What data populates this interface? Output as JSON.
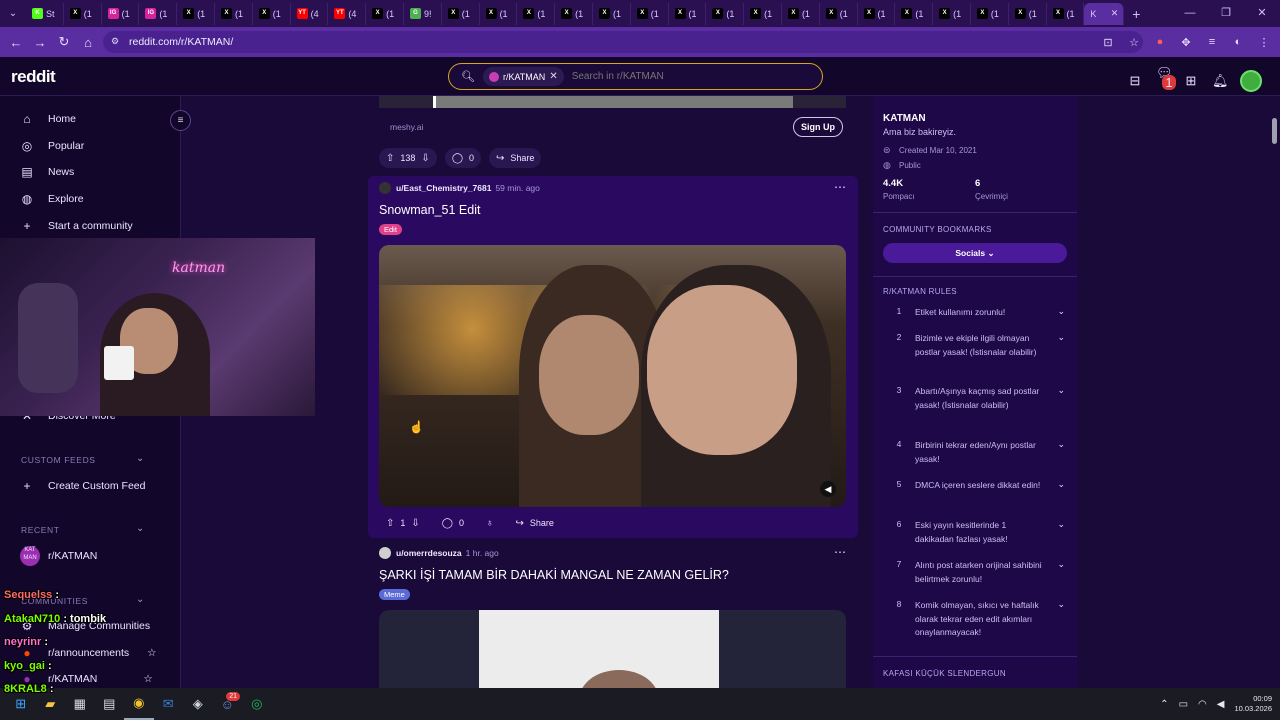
{
  "browser": {
    "tabs": [
      {
        "label": "St",
        "icon": "K",
        "color": "#53fc18"
      },
      {
        "label": "(1",
        "icon": "X",
        "color": "#000000"
      },
      {
        "label": "(1",
        "icon": "IG",
        "color": "#d6249f"
      },
      {
        "label": "(1",
        "icon": "IG",
        "color": "#d6249f"
      },
      {
        "label": "(1",
        "icon": "X",
        "color": "#000000"
      },
      {
        "label": "(1",
        "icon": "X",
        "color": "#000000"
      },
      {
        "label": "(1",
        "icon": "X",
        "color": "#000000"
      },
      {
        "label": "(4",
        "icon": "YT",
        "color": "#ff0000"
      },
      {
        "label": "(4",
        "icon": "YT",
        "color": "#ff0000"
      },
      {
        "label": "(1",
        "icon": "X",
        "color": "#000000"
      },
      {
        "label": "9!",
        "icon": "G",
        "color": "#4caf50"
      },
      {
        "label": "(1",
        "icon": "X",
        "color": "#000000"
      },
      {
        "label": "(1",
        "icon": "X",
        "color": "#000000"
      },
      {
        "label": "(1",
        "icon": "X",
        "color": "#000000"
      },
      {
        "label": "(1",
        "icon": "X",
        "color": "#000000"
      },
      {
        "label": "(1",
        "icon": "X",
        "color": "#000000"
      },
      {
        "label": "(1",
        "icon": "X",
        "color": "#000000"
      },
      {
        "label": "(1",
        "icon": "X",
        "color": "#000000"
      },
      {
        "label": "(1",
        "icon": "X",
        "color": "#000000"
      },
      {
        "label": "(1",
        "icon": "X",
        "color": "#000000"
      },
      {
        "label": "(1",
        "icon": "X",
        "color": "#000000"
      },
      {
        "label": "(1",
        "icon": "X",
        "color": "#000000"
      },
      {
        "label": "(1",
        "icon": "X",
        "color": "#000000"
      },
      {
        "label": "(1",
        "icon": "X",
        "color": "#000000"
      },
      {
        "label": "(1",
        "icon": "X",
        "color": "#000000"
      },
      {
        "label": "(1",
        "icon": "X",
        "color": "#000000"
      },
      {
        "label": "(1",
        "icon": "X",
        "color": "#000000"
      },
      {
        "label": "(1",
        "icon": "X",
        "color": "#000000"
      }
    ],
    "active_tab_label": "K",
    "url": "reddit.com/r/KATMAN/"
  },
  "header": {
    "logo": "reddit",
    "search_chip": "r/KATMAN",
    "search_placeholder": "Search in r/KATMAN",
    "chat_badge": "1"
  },
  "leftnav": {
    "items": [
      {
        "label": "Home",
        "icon": "⌂"
      },
      {
        "label": "Popular",
        "icon": "◎"
      },
      {
        "label": "News",
        "icon": "▤"
      },
      {
        "label": "Explore",
        "icon": "◍"
      },
      {
        "label": "Start a community",
        "icon": "+"
      }
    ],
    "discover_more": "Discover More",
    "custom_feeds_heading": "CUSTOM FEEDS",
    "create_custom_feed": "Create Custom Feed",
    "recent_heading": "RECENT",
    "recent_item": "r/KATMAN",
    "recent_item_avatar": "KAT MAN",
    "communities_heading": "COMMUNITIES",
    "manage_communities": "Manage Communities",
    "announcements": "r/announcements",
    "katman": "r/KATMAN"
  },
  "chat_overlay": [
    {
      "user": "Sequelss",
      "msg": "",
      "color": "#ff6b6b"
    },
    {
      "user": "AtakaN710",
      "msg": "tombik",
      "color": "#7cfc00"
    },
    {
      "user": "neyrinr",
      "msg": "",
      "color": "#ff6fcf"
    },
    {
      "user": "kyo_gai",
      "msg": "",
      "color": "#7cfc00"
    },
    {
      "user": "8KRAL8",
      "msg": "",
      "color": "#7cfc00"
    }
  ],
  "feed": {
    "ad": {
      "source": "meshy.ai",
      "signup": "Sign Up",
      "votes": "138",
      "comments": "0",
      "share": "Share"
    },
    "post1": {
      "user": "u/East_Chemistry_7681",
      "time": "59 min. ago",
      "title": "Snowman_51 Edit",
      "flair": "Edit",
      "flair_color": "#e0418a",
      "votes": "1",
      "comments": "0",
      "share": "Share"
    },
    "post2": {
      "user": "u/omerrdesouza",
      "time": "1 hr. ago",
      "title": "ŞARKI İŞİ TAMAM BİR DAHAKİ MANGAL NE ZAMAN GELİR?",
      "flair": "Meme",
      "flair_color": "#5b6bd6"
    }
  },
  "sidebar": {
    "name": "KATMAN",
    "description": "Ama biz bakireyiz.",
    "created": "Created Mar 10, 2021",
    "visibility": "Public",
    "members": "4.4K",
    "members_label": "Pompacı",
    "online": "6",
    "online_label": "Çevrimiçi",
    "bookmarks_heading": "COMMUNITY BOOKMARKS",
    "socials": "Socials",
    "rules_heading": "R/KATMAN RULES",
    "rules": [
      {
        "n": "1",
        "text": "Etiket kullanımı zorunlu!"
      },
      {
        "n": "2",
        "text": "Bizimle ve ekiple ilgili olmayan postlar yasak! (İstisnalar olabilir)"
      },
      {
        "n": "3",
        "text": "Abartı/Aşınya kaçmış sad postlar yasak! (İstisnalar olabilir)"
      },
      {
        "n": "4",
        "text": "Birbirini tekrar eden/Aynı postlar yasak!"
      },
      {
        "n": "5",
        "text": "DMCA içeren seslere dikkat edin!"
      },
      {
        "n": "6",
        "text": "Eski yayın kesitlerinde 1 dakikadan fazlası yasak!"
      },
      {
        "n": "7",
        "text": "Alıntı post atarken orijinal sahibini belirtmek zorunlu!"
      },
      {
        "n": "8",
        "text": "Komik olmayan, sıkıcı ve haftalık olarak tekrar eden edit akımları onaylanmayacak!"
      }
    ],
    "next_heading": "KAFASI KÜÇÜK SLENDERGUN"
  },
  "taskbar": {
    "time": "00:09",
    "date": "10.03.2026",
    "discord_badge": "21"
  }
}
